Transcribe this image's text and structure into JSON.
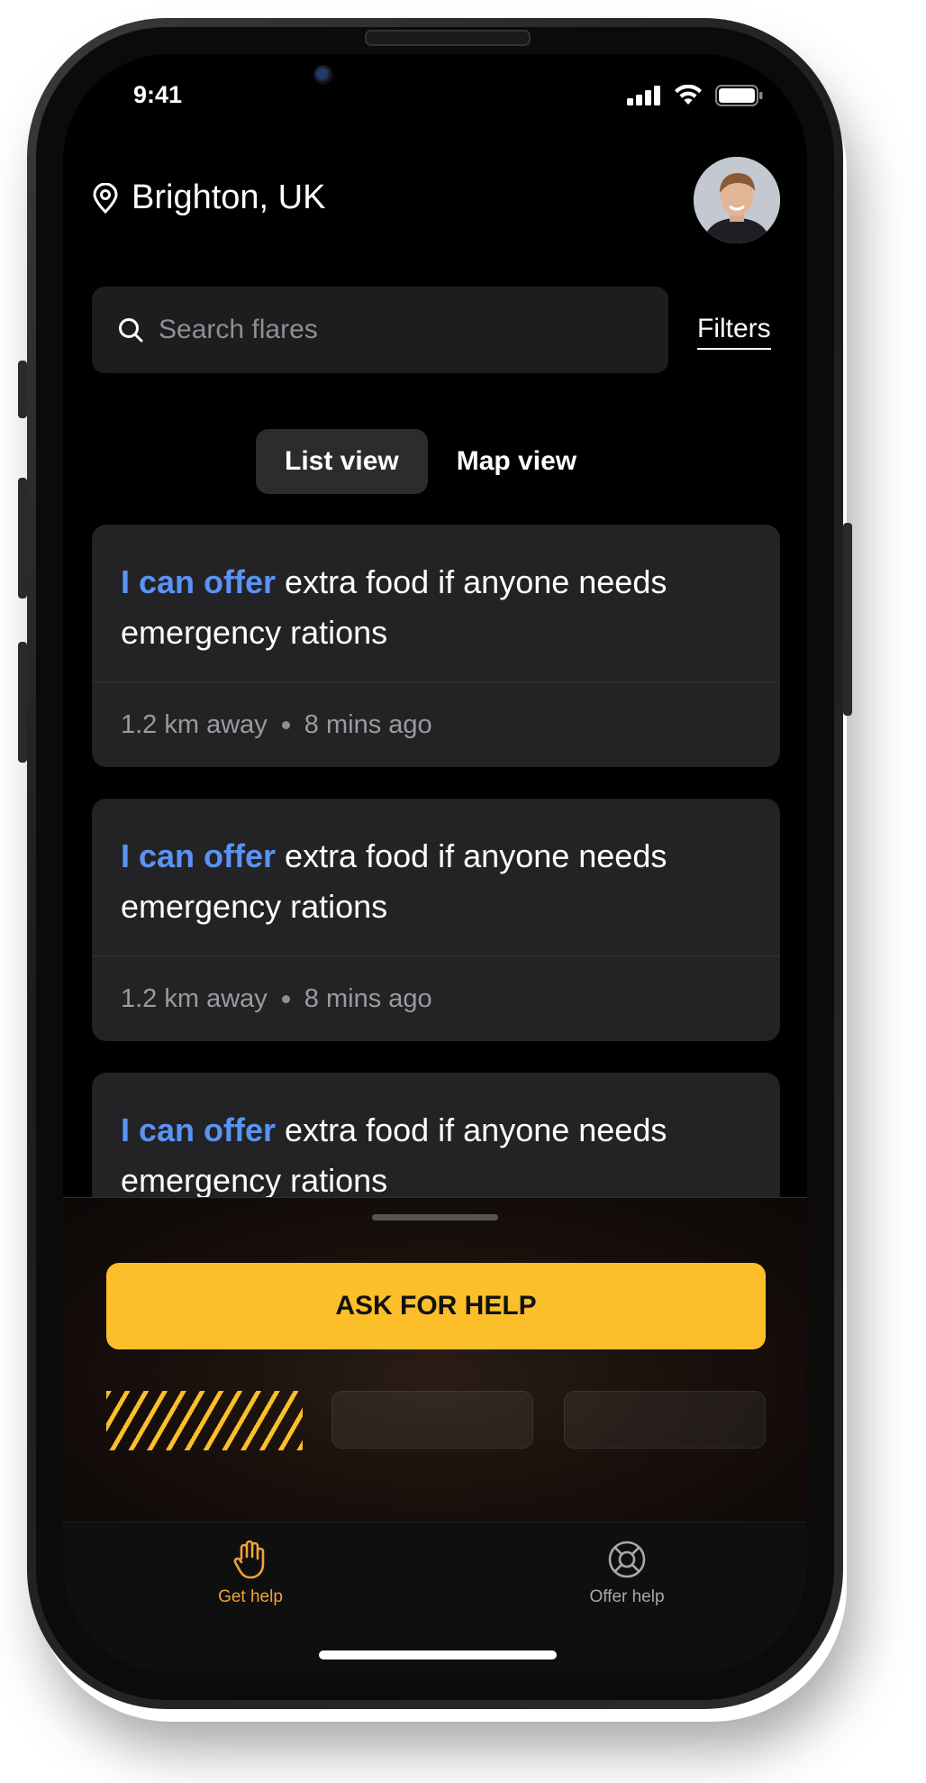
{
  "status": {
    "time": "9:41"
  },
  "header": {
    "location": "Brighton, UK"
  },
  "search": {
    "placeholder": "Search flares",
    "filters_label": "Filters"
  },
  "view_toggle": {
    "list_label": "List view",
    "map_label": "Map view",
    "active": "List view"
  },
  "cards": [
    {
      "keyword": "I can offer",
      "text": " extra food if anyone needs emergency rations",
      "distance": "1.2 km away",
      "time": "8 mins ago"
    },
    {
      "keyword": "I can offer",
      "text": " extra food if anyone needs emergency rations",
      "distance": "1.2 km away",
      "time": "8 mins ago"
    },
    {
      "keyword": "I can offer",
      "text": " extra food if anyone needs emergency rations"
    }
  ],
  "sheet": {
    "ask_label": "ASK FOR HELP"
  },
  "tabbar": {
    "items": [
      {
        "label": "Get help",
        "icon": "hand-icon",
        "active": true
      },
      {
        "label": "Offer help",
        "icon": "lifebuoy-icon",
        "active": false
      }
    ]
  },
  "colors": {
    "accent_blue": "#5b93f5",
    "accent_yellow": "#fcbf2a",
    "tab_active": "#f2a23a",
    "background": "#000000"
  }
}
